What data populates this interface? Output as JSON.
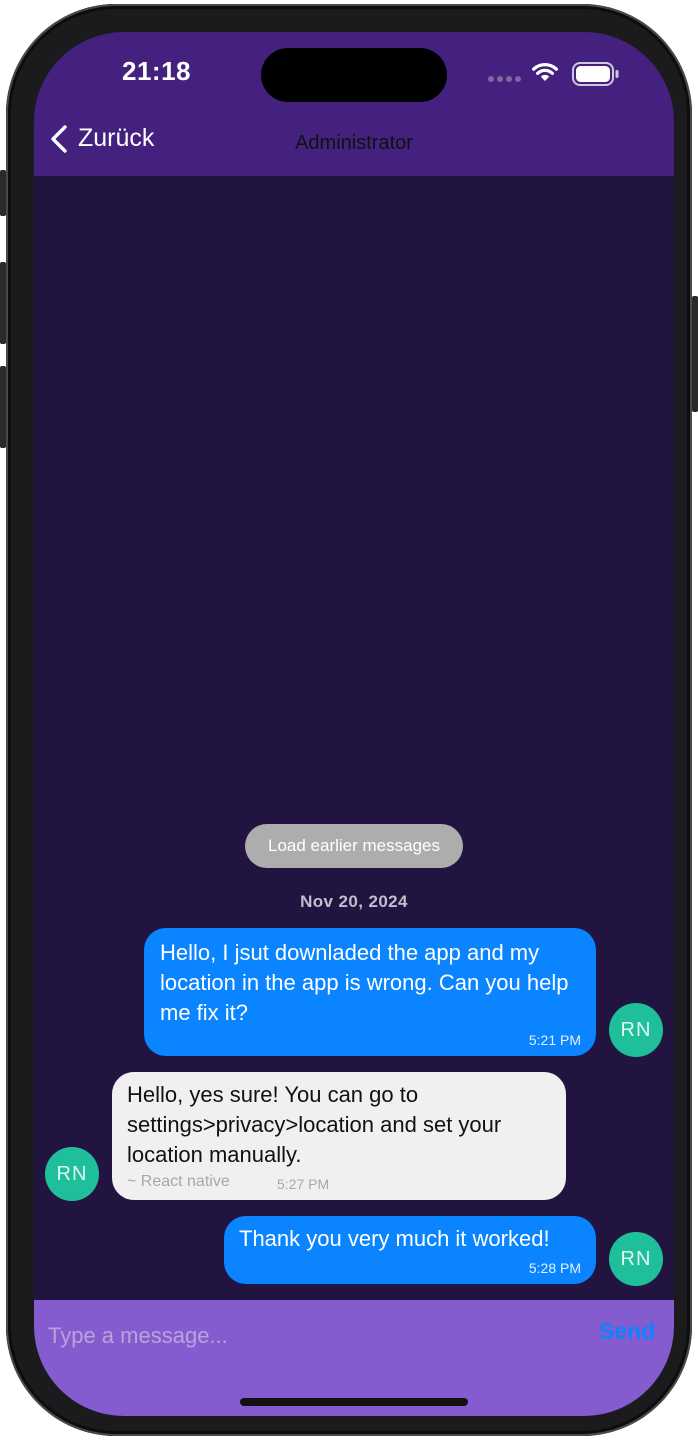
{
  "status_bar": {
    "time": "21:18"
  },
  "nav": {
    "back_label": "Zurück",
    "title": "Administrator"
  },
  "chat": {
    "load_earlier": "Load earlier messages",
    "date": "Nov 20, 2024",
    "messages": [
      {
        "side": "right",
        "text": "Hello, I jsut downladed the app and my location in the app is wrong. Can you help me fix it?",
        "time": "5:21 PM",
        "avatar": "RN"
      },
      {
        "side": "left",
        "text": "Hello, yes sure! You can go to settings>privacy>location and set your location manually.",
        "user": "~ React native",
        "time": "5:27 PM",
        "avatar": "RN"
      },
      {
        "side": "right",
        "text": "Thank you very much it worked!",
        "time": "5:28 PM",
        "avatar": "RN"
      }
    ]
  },
  "composer": {
    "placeholder": "Type a message...",
    "send_label": "Send"
  },
  "colors": {
    "header": "#44217f",
    "chat_background": "#221440",
    "outgoing_bubble": "#0a84ff",
    "incoming_bubble": "#f0f0f0",
    "avatar": "#1fbf9b",
    "composer": "#855ccf",
    "load_earlier": "#adadad"
  },
  "icons": {
    "back": "chevron-left-icon",
    "wifi": "wifi-icon",
    "battery": "battery-icon",
    "signal": "cellular-signal-icon"
  }
}
